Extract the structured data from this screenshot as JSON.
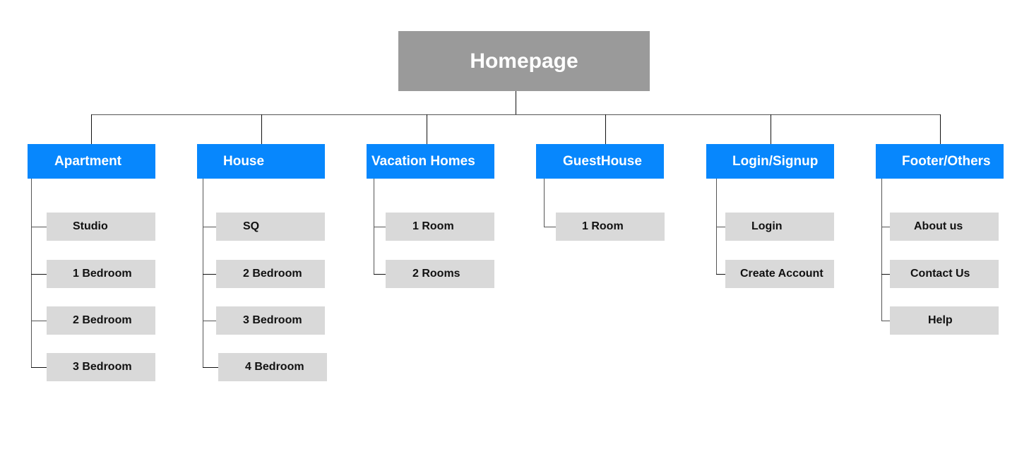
{
  "diagram": {
    "title": "Homepage",
    "colors": {
      "root": "#9a9a9a",
      "category": "#0787fd",
      "leaf": "#d9d9d9",
      "connector": "#555555"
    },
    "categories": [
      {
        "label": "Apartment",
        "children": [
          "Studio",
          "1 Bedroom",
          "2 Bedroom",
          "3 Bedroom"
        ]
      },
      {
        "label": "House",
        "children": [
          "SQ",
          "2 Bedroom",
          "3 Bedroom",
          "4 Bedroom"
        ]
      },
      {
        "label": "Vacation Homes",
        "children": [
          "1 Room",
          "2 Rooms"
        ]
      },
      {
        "label": "GuestHouse",
        "children": [
          "1 Room"
        ]
      },
      {
        "label": "Login/Signup",
        "children": [
          "Login",
          "Create Account"
        ]
      },
      {
        "label": "Footer/Others",
        "children": [
          "About us",
          "Contact Us",
          "Help"
        ]
      }
    ]
  }
}
